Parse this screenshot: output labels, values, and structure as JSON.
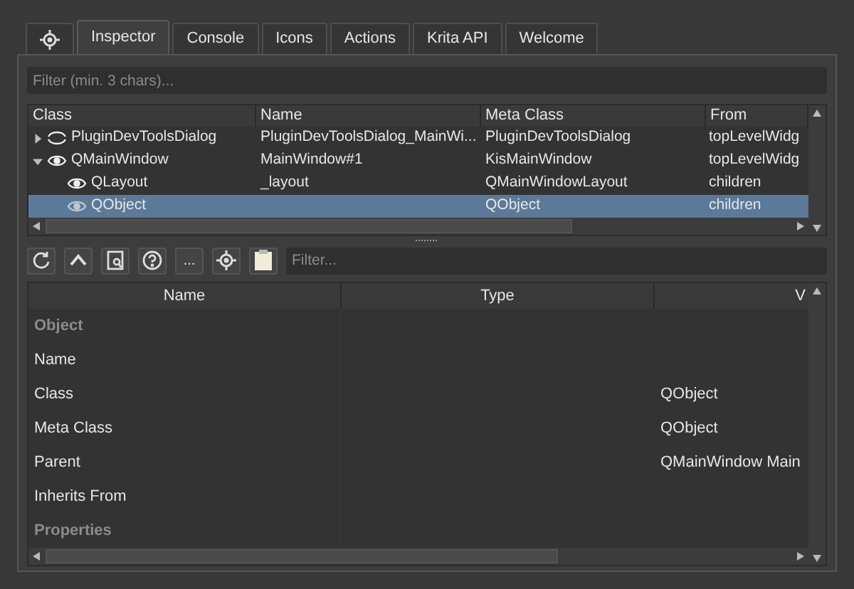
{
  "tabs": [
    {
      "kind": "icon",
      "selected": false
    },
    {
      "kind": "text",
      "label": "Inspector",
      "selected": true
    },
    {
      "kind": "text",
      "label": "Console",
      "selected": false
    },
    {
      "kind": "text",
      "label": "Icons",
      "selected": false
    },
    {
      "kind": "text",
      "label": "Actions",
      "selected": false
    },
    {
      "kind": "text",
      "label": "Krita API",
      "selected": false
    },
    {
      "kind": "text",
      "label": "Welcome",
      "selected": false
    }
  ],
  "filter": {
    "placeholder": "Filter (min. 3 chars)..."
  },
  "tree": {
    "columns": [
      "Class",
      "Name",
      "Meta Class",
      "From"
    ],
    "rows": [
      {
        "class": "PluginDevToolsDialog",
        "name": "PluginDevToolsDialog_MainWi...",
        "meta_class": "PluginDevToolsDialog",
        "from": "topLevelWidg",
        "visible": false,
        "expanded": false,
        "selected": false
      },
      {
        "class": "QMainWindow",
        "name": "MainWindow#1",
        "meta_class": "KisMainWindow",
        "from": "topLevelWidg",
        "visible": true,
        "expanded": true,
        "selected": false,
        "children": [
          {
            "class": "QLayout",
            "name": "_layout",
            "meta_class": "QMainWindowLayout",
            "from": "children",
            "visible": true,
            "selected": false
          },
          {
            "class": "QObject",
            "meta_class": "QObject",
            "from": "children",
            "visible": true,
            "selected": true
          }
        ]
      }
    ]
  },
  "toolbar": {
    "buttons": [
      {
        "kind": "refresh"
      },
      {
        "kind": "up"
      },
      {
        "kind": "find"
      },
      {
        "kind": "help"
      },
      {
        "kind": "text",
        "label": "..."
      },
      {
        "kind": "target"
      },
      {
        "kind": "clipboard"
      }
    ],
    "filter": {
      "placeholder": "Filter..."
    }
  },
  "properties": {
    "columns": [
      "Name",
      "Type"
    ],
    "column_3": "V",
    "rows": [
      {
        "kind": "group",
        "name": "Object"
      },
      {
        "kind": "item",
        "name": "Name"
      },
      {
        "kind": "item",
        "name": "Class",
        "value": "QObject"
      },
      {
        "kind": "item",
        "name": "Meta Class",
        "value": "QObject"
      },
      {
        "kind": "item",
        "name": "Parent",
        "value": "QMainWindow Main"
      },
      {
        "kind": "item",
        "name": "Inherits From"
      },
      {
        "kind": "group",
        "name": "Properties"
      }
    ]
  }
}
